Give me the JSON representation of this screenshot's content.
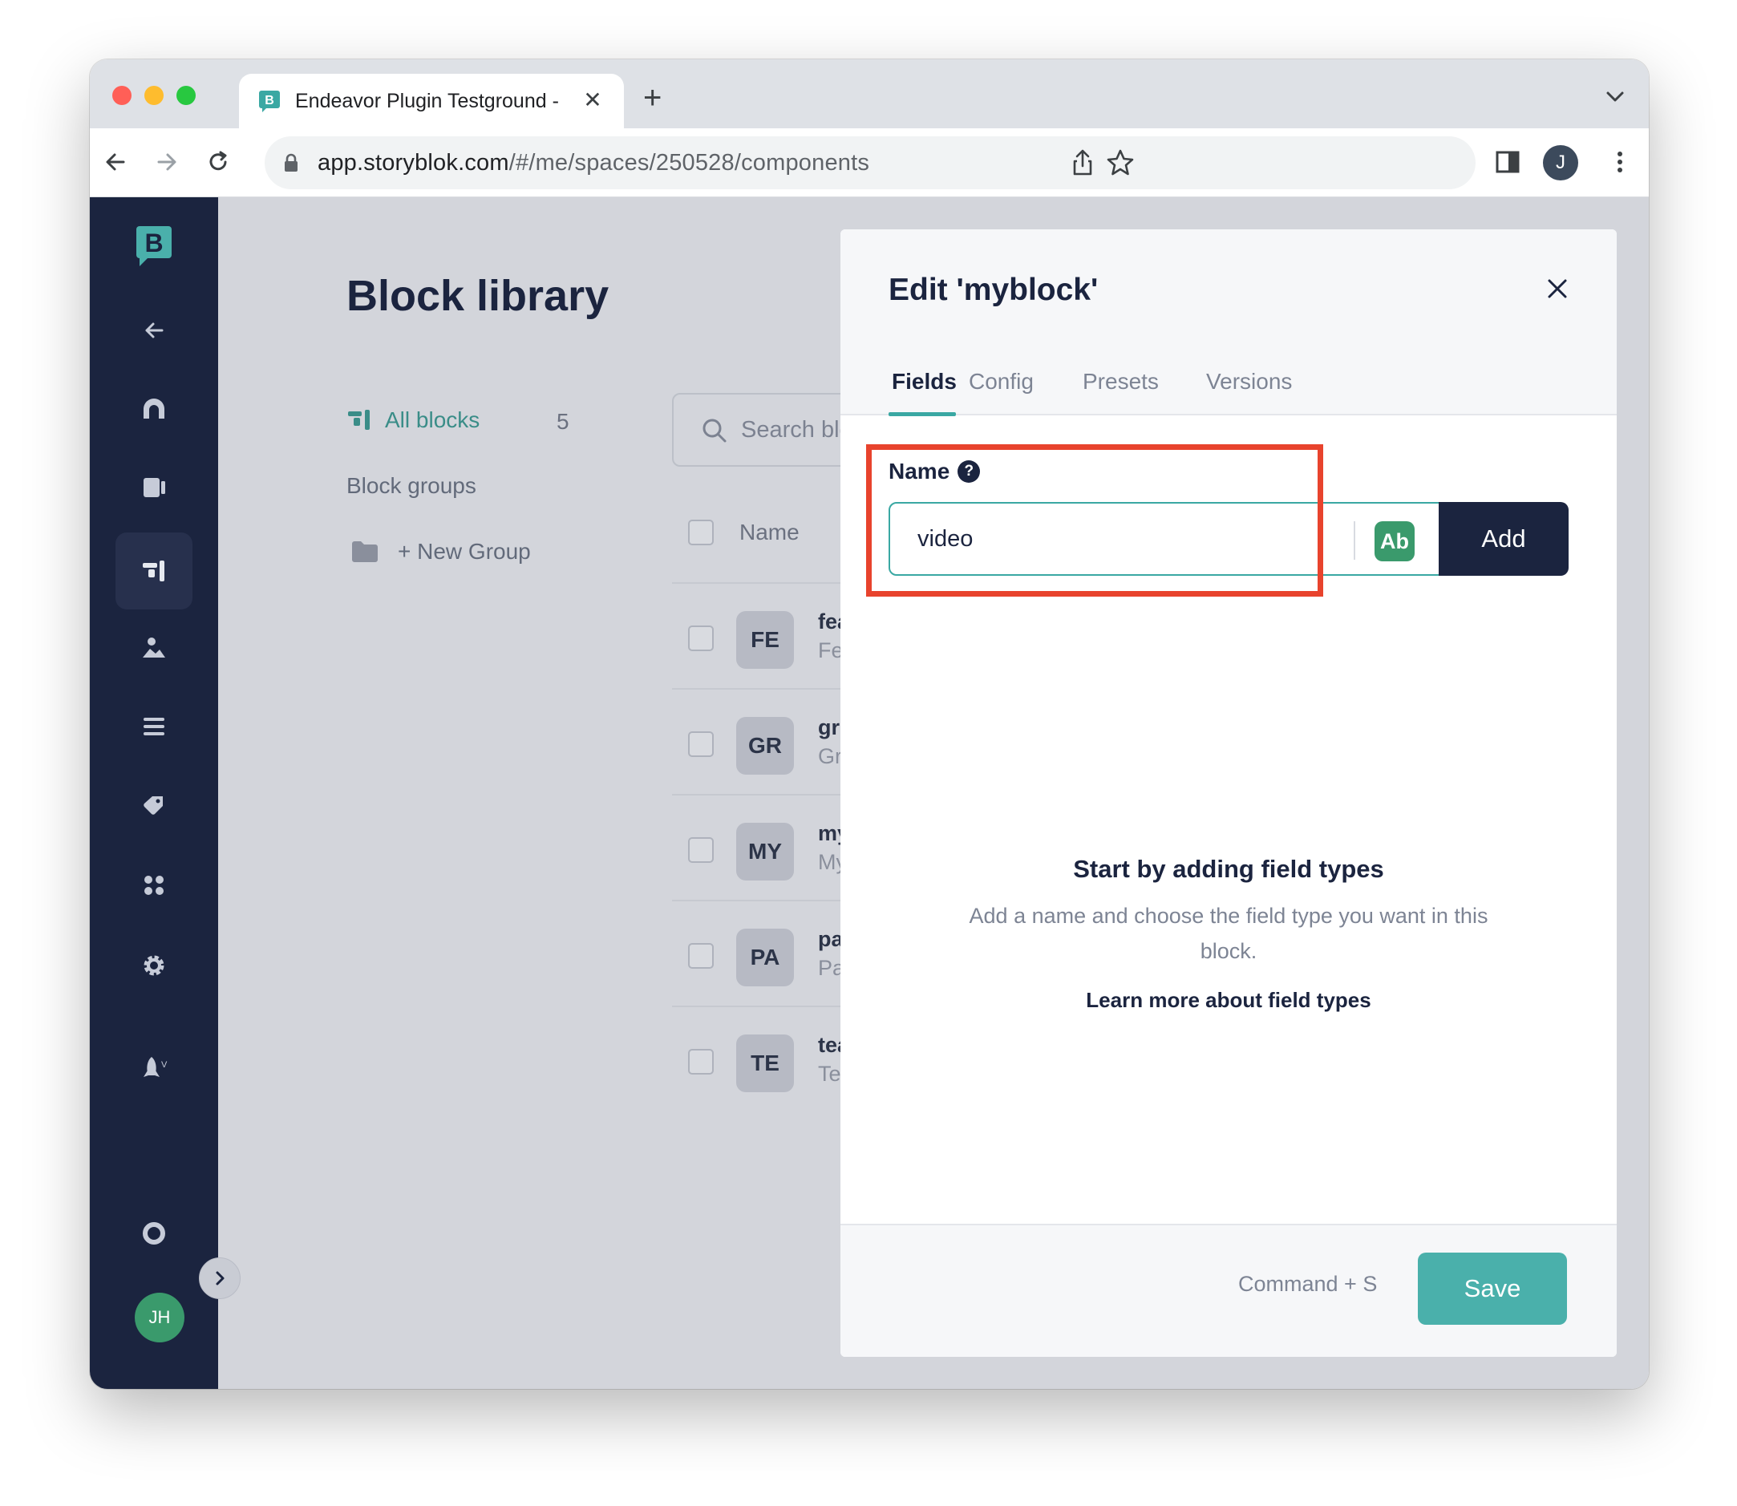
{
  "browser": {
    "tab_title": "Endeavor Plugin Testground -",
    "tab_close": "✕",
    "new_tab": "+",
    "url_host": "app.storyblok.com",
    "url_path": "/#/me/spaces/250528/components",
    "profile_initial": "J",
    "traffic_lights": [
      "#ff5f57",
      "#febc2e",
      "#28c840"
    ]
  },
  "sidebar": {
    "logo_letter": "B",
    "avatar_initials": "JH",
    "icons": [
      "back-arrow-icon",
      "home-icon",
      "content-icon",
      "block-library-icon",
      "assets-icon",
      "datasources-icon",
      "tags-icon",
      "apps-icon",
      "settings-icon",
      "release-icon",
      "help-icon"
    ],
    "active_item": "block-library-icon"
  },
  "library": {
    "title": "Block library",
    "all_blocks_label": "All blocks",
    "all_blocks_count": "5",
    "block_groups_label": "Block groups",
    "new_group_label": "+ New Group",
    "search_placeholder": "Search blocks",
    "column_name": "Name",
    "rows": [
      {
        "badge": "FE",
        "name": "fea",
        "desc": "Fe"
      },
      {
        "badge": "GR",
        "name": "gri",
        "desc": "Gr"
      },
      {
        "badge": "MY",
        "name": "my",
        "desc": "My"
      },
      {
        "badge": "PA",
        "name": "pa",
        "desc": "Pa"
      },
      {
        "badge": "TE",
        "name": "tea",
        "desc": "Te"
      }
    ]
  },
  "panel": {
    "title": "Edit 'myblock'",
    "tabs": [
      "Fields",
      "Config",
      "Presets",
      "Versions"
    ],
    "active_tab": "Fields",
    "name_label": "Name",
    "help_glyph": "?",
    "name_value": "video",
    "type_chip": "Ab",
    "add_label": "Add",
    "empty_title": "Start by adding field types",
    "empty_desc": "Add a name and choose the field type you want in this block.",
    "learn_more": "Learn more about field types",
    "shortcut": "Command + S",
    "save_label": "Save"
  },
  "colors": {
    "sidebar_bg": "#1b243f",
    "accent": "#3aa8a3",
    "save": "#4ab0ab",
    "highlight": "#e8432d",
    "chip_green": "#3a9a6c"
  }
}
